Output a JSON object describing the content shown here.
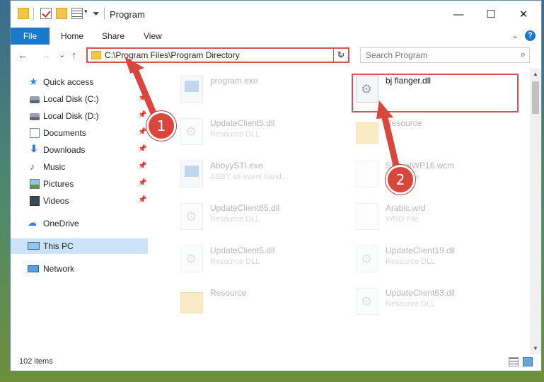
{
  "window": {
    "title": "Program",
    "controls": {
      "minimize": "—",
      "maximize": "☐",
      "close": "✕"
    }
  },
  "ribbon": {
    "tabs": [
      {
        "label": "File"
      },
      {
        "label": "Home"
      },
      {
        "label": "Share"
      },
      {
        "label": "View"
      }
    ],
    "help": "?"
  },
  "navigation": {
    "back": "←",
    "forward": "→",
    "recent": "⌄",
    "up": "↑",
    "address": "C:\\Program Files\\Program Directory",
    "refresh": "↻",
    "search_placeholder": "Search Program",
    "search_icon": "⌕"
  },
  "sidebar": {
    "items": [
      {
        "label": "Quick access",
        "icon": "star-icon"
      },
      {
        "label": "Local Disk (C:)",
        "icon": "disk-icon",
        "pinned": true
      },
      {
        "label": "Local Disk (D:)",
        "icon": "disk-icon",
        "pinned": true
      },
      {
        "label": "Documents",
        "icon": "documents-icon",
        "pinned": true
      },
      {
        "label": "Downloads",
        "icon": "download-icon",
        "pinned": true
      },
      {
        "label": "Music",
        "icon": "music-icon",
        "pinned": true
      },
      {
        "label": "Pictures",
        "icon": "pictures-icon",
        "pinned": true
      },
      {
        "label": "Videos",
        "icon": "videos-icon",
        "pinned": true
      },
      {
        "label": "OneDrive",
        "icon": "cloud-icon"
      },
      {
        "label": "This PC",
        "icon": "computer-icon",
        "selected": true
      },
      {
        "label": "Network",
        "icon": "network-icon"
      }
    ]
  },
  "files": [
    {
      "name": "program.exe",
      "type": "",
      "icon": "exe"
    },
    {
      "name": "bj flanger.dll",
      "type": "",
      "icon": "dll",
      "highlighted": true
    },
    {
      "name": "UpdateClient5.dll",
      "type": "Resource DLL",
      "icon": "dll"
    },
    {
      "name": "Resource",
      "type": "",
      "icon": "folder"
    },
    {
      "name": "AbbyySTI.exe",
      "type": "ABBY sti event hand...",
      "icon": "exe"
    },
    {
      "name": "SndvolWP16.wcm",
      "type": "WCM File",
      "icon": "blank"
    },
    {
      "name": "UpdateClient65.dll",
      "type": "Resource DLL",
      "icon": "dll"
    },
    {
      "name": "Arabic.wrd",
      "type": "WRD File",
      "icon": "blank"
    },
    {
      "name": "UpdateClient5.dll",
      "type": "Resource DLL",
      "icon": "dll"
    },
    {
      "name": "UpdateClient19.dll",
      "type": "Resource DLL",
      "icon": "dll"
    },
    {
      "name": "Resource",
      "type": "",
      "icon": "folder"
    },
    {
      "name": "UpdateClient63.dll",
      "type": "Resource DLL",
      "icon": "dll"
    }
  ],
  "status": {
    "item_count": "102 items"
  },
  "annotations": [
    {
      "label": "1"
    },
    {
      "label": "2"
    }
  ],
  "colors": {
    "accent": "#1979ca",
    "annotation": "#d9534f",
    "selection": "#cce4f7"
  }
}
